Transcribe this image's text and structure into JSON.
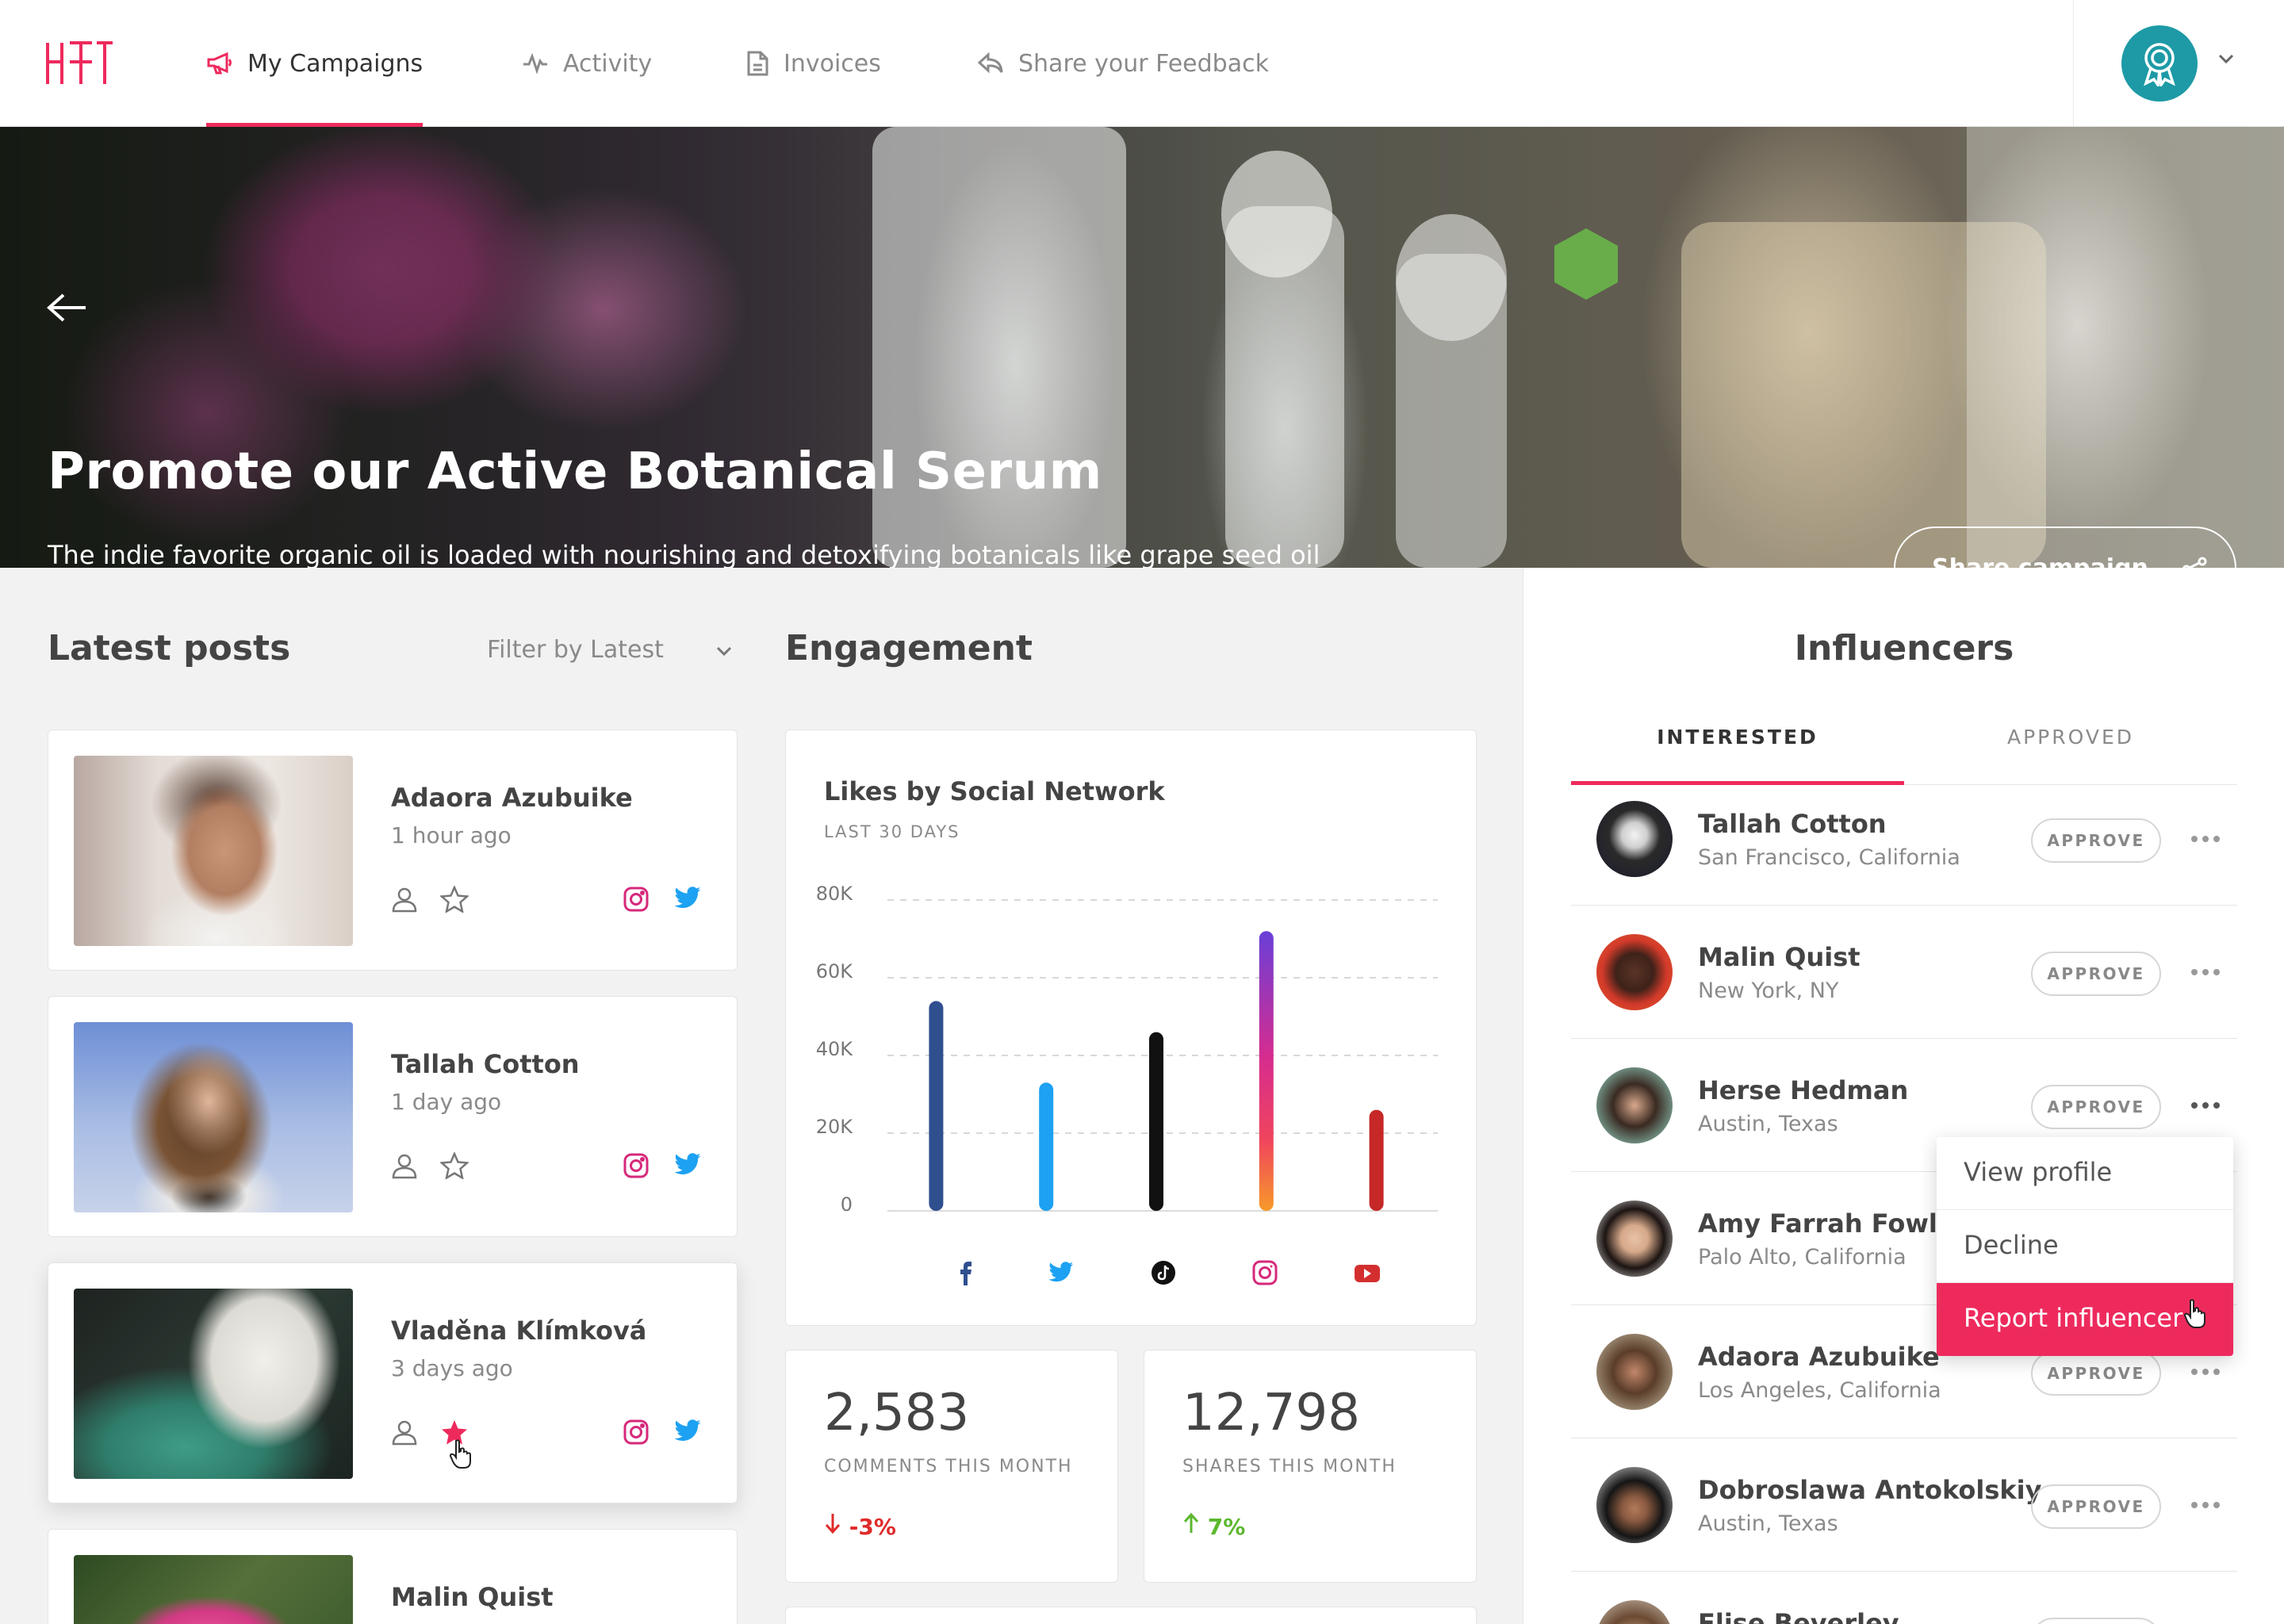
{
  "nav": {
    "items": [
      {
        "label": "My Campaigns",
        "icon": "megaphone-icon",
        "active": true
      },
      {
        "label": "Activity",
        "icon": "activity-icon",
        "active": false
      },
      {
        "label": "Invoices",
        "icon": "invoice-icon",
        "active": false
      },
      {
        "label": "Share your Feedback",
        "icon": "feedback-icon",
        "active": false
      }
    ]
  },
  "account": {
    "icon": "award-icon",
    "color": "#1d9aa6"
  },
  "hero": {
    "title": "Promote our Active Botanical Serum",
    "description": "The indie favorite organic oil is loaded with nourishing and detoxifying botanicals like grape seed oil and dandelion leaf, inspired by founder April Gargiulo's family winery in California.",
    "share_label": "Share campaign"
  },
  "posts": {
    "title": "Latest posts",
    "filter_label": "Filter by Latest",
    "items": [
      {
        "name": "Adaora Azubuike",
        "time": "1 hour ago",
        "starred": false
      },
      {
        "name": "Tallah Cotton",
        "time": "1 day ago",
        "starred": false
      },
      {
        "name": "Vladěna Klímková",
        "time": "3 days ago",
        "starred": true
      },
      {
        "name": "Malin Quist",
        "time": "",
        "starred": false
      }
    ]
  },
  "engagement": {
    "title": "Engagement",
    "stats": [
      {
        "value": "2,583",
        "label": "COMMENTS THIS MONTH",
        "change": "-3%",
        "direction": "down",
        "color": "#e02b2b"
      },
      {
        "value": "12,798",
        "label": "SHARES THIS MONTH",
        "change": "7%",
        "direction": "up",
        "color": "#5cb82e"
      }
    ]
  },
  "chart_data": {
    "type": "bar",
    "title": "Likes by Social Network",
    "subtitle": "LAST 30 DAYS",
    "categories": [
      "facebook-icon",
      "twitter-icon",
      "tiktok-icon",
      "instagram-icon",
      "youtube-icon"
    ],
    "values": [
      54000,
      33000,
      46000,
      72000,
      26000
    ],
    "colors": [
      "#2f4f8f",
      "#1da1f2",
      "#111111",
      "instagram-gradient",
      "#c62828"
    ],
    "ylim": [
      0,
      80000
    ],
    "yticks": [
      "0",
      "20K",
      "40K",
      "60K",
      "80K"
    ],
    "grid": true
  },
  "influencers": {
    "title": "Influencers",
    "tabs": [
      "INTERESTED",
      "APPROVED"
    ],
    "approve_label": "APPROVE",
    "items": [
      {
        "name": "Tallah Cotton",
        "location": "San Francisco, California"
      },
      {
        "name": "Malin Quist",
        "location": "New York, NY"
      },
      {
        "name": "Herse Hedman",
        "location": "Austin, Texas"
      },
      {
        "name": "Amy Farrah Fowler",
        "location": "Palo Alto, California"
      },
      {
        "name": "Adaora Azubuike",
        "location": "Los Angeles, California"
      },
      {
        "name": "Dobroslawa Antokolskiy",
        "location": "Austin, Texas"
      },
      {
        "name": "Elise Beverley",
        "location": ""
      }
    ],
    "menu": [
      "View profile",
      "Decline",
      "Report influencer"
    ]
  },
  "colors": {
    "accent": "#ee2a5d",
    "teal": "#1d9aa6"
  }
}
